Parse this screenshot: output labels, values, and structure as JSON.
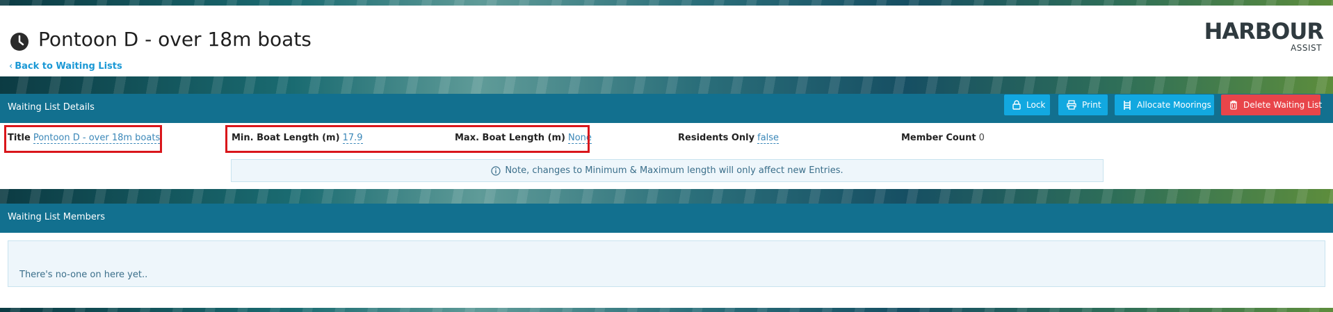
{
  "header": {
    "title": "Pontoon D - over 18m boats",
    "back_link": "Back to Waiting Lists",
    "logo_text": "HARBOUR",
    "logo_sub": "ASSIST"
  },
  "details": {
    "section_title": "Waiting List Details",
    "buttons": {
      "lock": "Lock",
      "print": "Print",
      "allocate": "Allocate Moorings",
      "delete": "Delete Waiting List"
    },
    "fields": {
      "title_label": "Title",
      "title_value": "Pontoon D - over 18m boats",
      "min_label": "Min. Boat Length (m)",
      "min_value": "17.9",
      "max_label": "Max. Boat Length (m)",
      "max_value": "None",
      "residents_label": "Residents Only",
      "residents_value": "false",
      "member_count_label": "Member Count",
      "member_count_value": "0"
    },
    "note": "Note, changes to Minimum & Maximum length will only affect new Entries."
  },
  "members": {
    "section_title": "Waiting List Members",
    "empty_text": "There's no-one on here yet.."
  },
  "colors": {
    "accent_bar": "#12708f",
    "button_blue": "#12a8e0",
    "button_red": "#e8454a",
    "link": "#1a98d5",
    "highlight": "#d9161b"
  },
  "icons": [
    "clock-icon",
    "chevron-left-icon",
    "lock-icon",
    "print-icon",
    "ladder-icon",
    "trash-icon",
    "info-icon"
  ]
}
